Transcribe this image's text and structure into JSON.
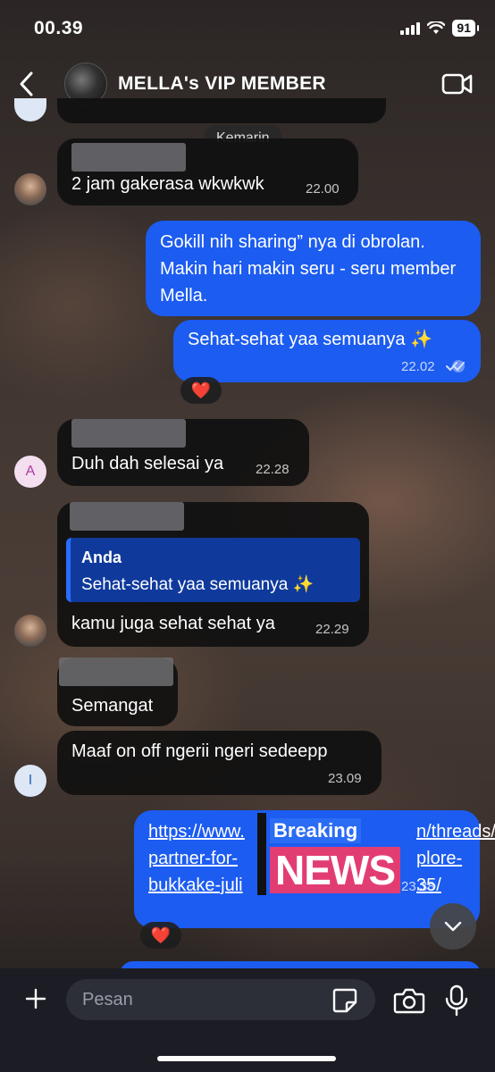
{
  "status": {
    "time": "00.39",
    "battery": "91"
  },
  "header": {
    "title": "MELLA's VIP MEMBER"
  },
  "date_divider": "Kemarin",
  "messages": [
    {
      "text": "2 jam gakerasa wkwkwk",
      "time": "22.00"
    },
    {
      "text": "Gokill nih sharing” nya di obrolan. Makin hari makin seru - seru member Mella."
    },
    {
      "text": "Sehat-sehat yaa semuanya ✨",
      "time": "22.02"
    },
    {
      "text": "Duh dah selesai ya",
      "time": "22.28",
      "avatar_letter": "A"
    },
    {
      "quote_author": "Anda",
      "quote_text": "Sehat-sehat yaa semuanya ✨",
      "text": "kamu juga sehat sehat ya",
      "time": "22.29"
    },
    {
      "text": "Semangat"
    },
    {
      "text": "Maaf on off ngerii ngeri sedeepp",
      "time": "23.09",
      "avatar_letter": "I"
    },
    {
      "link_lines": [
        "https://www.",
        "partner-for-",
        "bukkake-juli"
      ],
      "link_tail_lines": [
        "n/threads/",
        "plore-",
        "35/"
      ],
      "time": "23.38"
    }
  ],
  "reactions": {
    "heart": "❤️"
  },
  "sticker": {
    "top": "Breaking",
    "bottom": "NEWS"
  },
  "composer": {
    "placeholder": "Pesan"
  },
  "colors": {
    "outgoing_bubble": "#1c5cf0",
    "incoming_bubble": "#101010",
    "quote_bg": "#0f3a9c"
  }
}
